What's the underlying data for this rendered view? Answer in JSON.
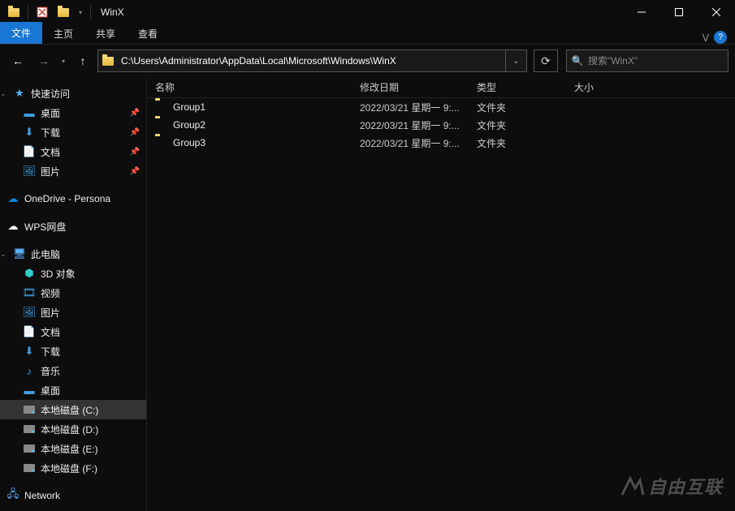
{
  "window": {
    "title": "WinX"
  },
  "ribbon": {
    "file": "文件",
    "home": "主页",
    "share": "共享",
    "view": "查看"
  },
  "address": {
    "path": "C:\\Users\\Administrator\\AppData\\Local\\Microsoft\\Windows\\WinX"
  },
  "search": {
    "placeholder": "搜索\"WinX\""
  },
  "sidebar": {
    "quick_access": "快速访问",
    "quick_items": [
      {
        "label": "桌面",
        "icon": "desktop",
        "pinned": true
      },
      {
        "label": "下载",
        "icon": "download",
        "pinned": true
      },
      {
        "label": "文档",
        "icon": "document",
        "pinned": true
      },
      {
        "label": "图片",
        "icon": "picture",
        "pinned": true
      }
    ],
    "onedrive": "OneDrive - Persona",
    "wps": "WPS网盘",
    "this_pc": "此电脑",
    "pc_items": [
      {
        "label": "3D 对象",
        "icon": "3d"
      },
      {
        "label": "视频",
        "icon": "video"
      },
      {
        "label": "图片",
        "icon": "picture"
      },
      {
        "label": "文档",
        "icon": "document"
      },
      {
        "label": "下载",
        "icon": "download"
      },
      {
        "label": "音乐",
        "icon": "music"
      },
      {
        "label": "桌面",
        "icon": "desktop"
      },
      {
        "label": "本地磁盘 (C:)",
        "icon": "drive",
        "selected": true
      },
      {
        "label": "本地磁盘 (D:)",
        "icon": "drive"
      },
      {
        "label": "本地磁盘 (E:)",
        "icon": "drive"
      },
      {
        "label": "本地磁盘 (F:)",
        "icon": "drive"
      }
    ],
    "network": "Network"
  },
  "columns": {
    "name": "名称",
    "date": "修改日期",
    "type": "类型",
    "size": "大小"
  },
  "files": [
    {
      "name": "Group1",
      "date": "2022/03/21 星期一 9:...",
      "type": "文件夹"
    },
    {
      "name": "Group2",
      "date": "2022/03/21 星期一 9:...",
      "type": "文件夹"
    },
    {
      "name": "Group3",
      "date": "2022/03/21 星期一 9:...",
      "type": "文件夹"
    }
  ],
  "watermark": "自由互联"
}
